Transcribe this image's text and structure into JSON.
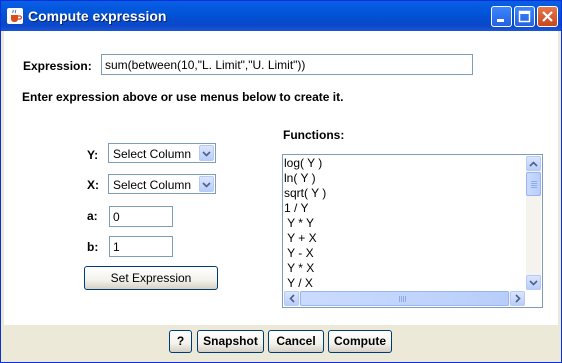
{
  "window": {
    "title": "Compute expression"
  },
  "expression": {
    "label": "Expression:",
    "value": "sum(between(10,\"L. Limit\",\"U. Limit\"))"
  },
  "instruction": "Enter expression above or use menus below to create it.",
  "form": {
    "y_label": "Y:",
    "y_select": "Select Column",
    "x_label": "X:",
    "x_select": "Select Column",
    "a_label": "a:",
    "a_value": "0",
    "b_label": "b:",
    "b_value": "1",
    "set_button": "Set Expression"
  },
  "functions": {
    "label": "Functions:",
    "items": [
      "log( Y )",
      "ln( Y )",
      "sqrt( Y )",
      "1 / Y",
      " Y * Y",
      " Y + X",
      " Y - X",
      " Y * X",
      " Y / X"
    ]
  },
  "footer": {
    "help": "?",
    "snapshot": "Snapshot",
    "cancel": "Cancel",
    "compute": "Compute"
  },
  "icons": {
    "app": "java-cup-icon",
    "minimize": "minimize-icon",
    "maximize": "maximize-icon",
    "close": "close-icon",
    "dropdown": "chevron-down-icon"
  },
  "colors": {
    "titlebar": "#0053d6",
    "close_button": "#c8461e",
    "dialog_bg": "#ece9d8",
    "content_bg": "#ffffff",
    "border": "#7f9db9"
  }
}
